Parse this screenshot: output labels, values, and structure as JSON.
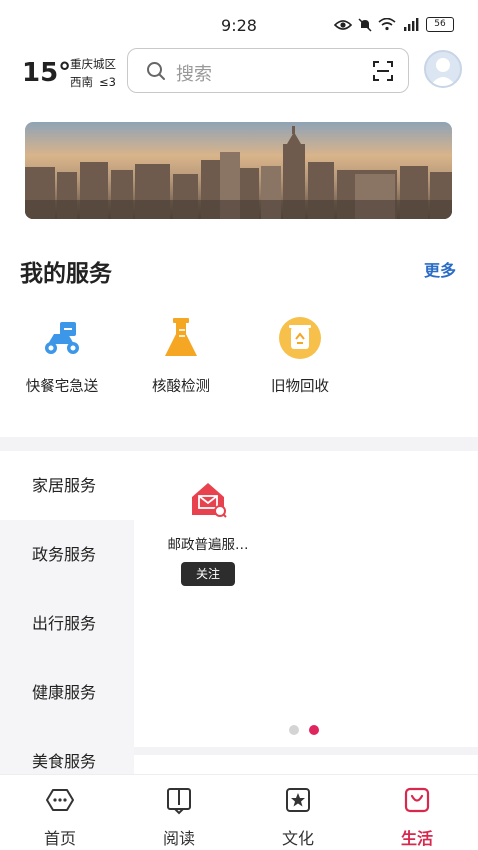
{
  "status_bar": {
    "time": "9:28",
    "battery": "56"
  },
  "header": {
    "temperature": "15°",
    "district": "重庆城区",
    "wind_direction": "西南",
    "wind_level": "≤3",
    "search_placeholder": "搜索"
  },
  "my_services": {
    "title": "我的服务",
    "more": "更多",
    "items": [
      {
        "label": "快餐宅急送",
        "icon": "delivery-scooter-icon"
      },
      {
        "label": "核酸检测",
        "icon": "flask-icon"
      },
      {
        "label": "旧物回收",
        "icon": "recycle-bin-icon"
      }
    ]
  },
  "categories": {
    "items": [
      "家居服务",
      "政务服务",
      "出行服务",
      "健康服务",
      "美食服务"
    ],
    "active_index": 0
  },
  "content": {
    "card": {
      "name": "邮政普遍服…",
      "follow": "关注",
      "icon": "post-office-house-icon"
    },
    "pager": {
      "total": 2,
      "active": 1
    }
  },
  "tabbar": {
    "items": [
      {
        "label": "首页",
        "icon": "home-bubble-icon"
      },
      {
        "label": "阅读",
        "icon": "book-icon"
      },
      {
        "label": "文化",
        "icon": "star-frame-icon"
      },
      {
        "label": "生活",
        "icon": "shopping-bag-icon"
      }
    ],
    "active_index": 3
  },
  "colors": {
    "accent": "#d8284d",
    "link": "#2a6cc7",
    "service_blue": "#3d97e8",
    "service_orange": "#f5a623"
  }
}
